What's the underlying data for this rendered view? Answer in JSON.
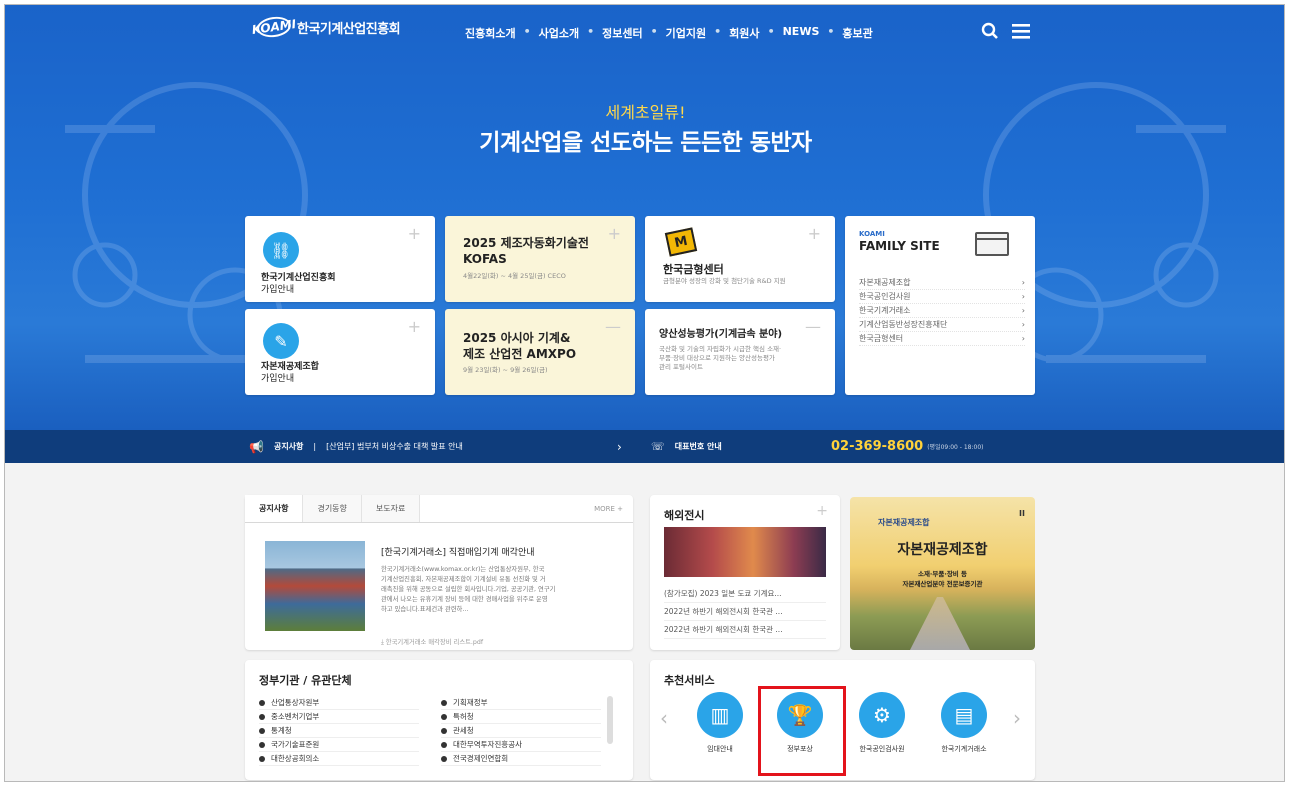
{
  "header": {
    "logo_mark": "KOAMI",
    "logo_name": "한국기계산업진흥회",
    "nav": [
      "진흥회소개",
      "사업소개",
      "정보센터",
      "기업지원",
      "회원사",
      "NEWS",
      "홍보관"
    ],
    "icons": [
      "search-icon",
      "menu-icon"
    ]
  },
  "hero": {
    "subtitle": "세계초일류!",
    "title": "기계산업을 선도하는 든든한 동반자"
  },
  "quick_cards": [
    {
      "label_1": "한국기계산업진흥회",
      "label_2": "가입안내",
      "icon": "link-icon"
    },
    {
      "title_1": "2025 제조자동화기술전",
      "title_2": "KOFAS",
      "desc": "4월22일(화) ~ 4월 25일(금) CECO"
    },
    {
      "title": "한국금형센터",
      "desc": "금형분야 성장의 강화 및 첨단기술 R&D 지원",
      "icon": "mold-center-logo-icon"
    },
    {
      "label_1": "자본재공제조합",
      "label_2": "가입안내",
      "icon": "wrench-icon"
    },
    {
      "title_1": "2025 아시아 기계&",
      "title_2": "제조 산업전 AMXPO",
      "desc": "9월 23일(화) ~ 9월 26일(금)"
    },
    {
      "title": "양산성능평가(기계금속 분야)",
      "desc_1": "국산화 및 기술의 자립화가 시급한 핵심 소재·",
      "desc_2": "부품·장비 대상으로 지원하는 양산성능평가",
      "desc_3": "관리 포털사이트"
    }
  ],
  "family_site": {
    "label": "KOAMI",
    "title": "FAMILY SITE",
    "items": [
      "자본재공제조합",
      "한국공인검사원",
      "한국기계거래소",
      "기계산업동반성장진흥재단",
      "한국금형센터"
    ]
  },
  "notice_bar": {
    "label": "공지사항",
    "text": "[산업부] 범부처 비상수출 대책 발표 안내",
    "phone_label": "대표번호 안내",
    "phone": "02-369-8600",
    "hours": "(평일09:00 - 18:00)"
  },
  "news_panel": {
    "tabs": [
      "공지사항",
      "경기동향",
      "보도자료"
    ],
    "more": "MORE +",
    "title": "[한국기계거래소] 직접매입기계 매각안내",
    "desc_1": "한국기계거래소(www.komax.or.kr)는 산업통상자원부, 한국",
    "desc_2": "기계산업진흥회, 자본재공제조합이 기계설비 유통 선진화 및 거",
    "desc_3": "래촉진을 위해 공동으로 설립한 회사입니다.기업, 공공기관, 연구기",
    "desc_4": "관에서 나오는 유휴기계 장비 등에 대한 경매사업을 위주로 운영",
    "desc_5": "하고 있습니다.표제건과 관련하...",
    "file": "한국기계거래소 매각장비 리스트.pdf"
  },
  "overseas": {
    "title": "해외전시",
    "items": [
      "(참가모집) 2023 일본 도쿄 기계요...",
      "2022년 하반기 해외전시회 한국관 ...",
      "2022년 하반기 해외전시회 한국관 ..."
    ]
  },
  "banner": {
    "logo_text": "자본재공제조합",
    "title": "자본재공제조합",
    "sub_1": "소재·부품·장비 등",
    "sub_2": "자본재산업분야 전문보증기관",
    "pause": "II"
  },
  "orgs": {
    "title": "정부기관 / 유관단체",
    "left": [
      "산업통상자원부",
      "중소벤처기업부",
      "통계청",
      "국가기술표준원",
      "대한상공회의소"
    ],
    "right": [
      "기획재정부",
      "특허청",
      "관세청",
      "대한무역투자진흥공사",
      "전국경제인연합회"
    ]
  },
  "services": {
    "title": "추천서비스",
    "items": [
      {
        "label": "임대안내",
        "icon": "building-icon"
      },
      {
        "label": "정부포상",
        "icon": "trophy-icon"
      },
      {
        "label": "한국공인검사원",
        "icon": "inspection-icon"
      },
      {
        "label": "한국기계거래소",
        "icon": "machine-exchange-icon"
      }
    ],
    "prev": "‹",
    "next": "›"
  },
  "colors": {
    "hero_blue": "#1f6fd3",
    "notice_bar": "#0f3d7c",
    "accent_yellow": "#ffd23a",
    "icon_blue": "#2aa4e8",
    "highlight_red": "#e3131b"
  }
}
